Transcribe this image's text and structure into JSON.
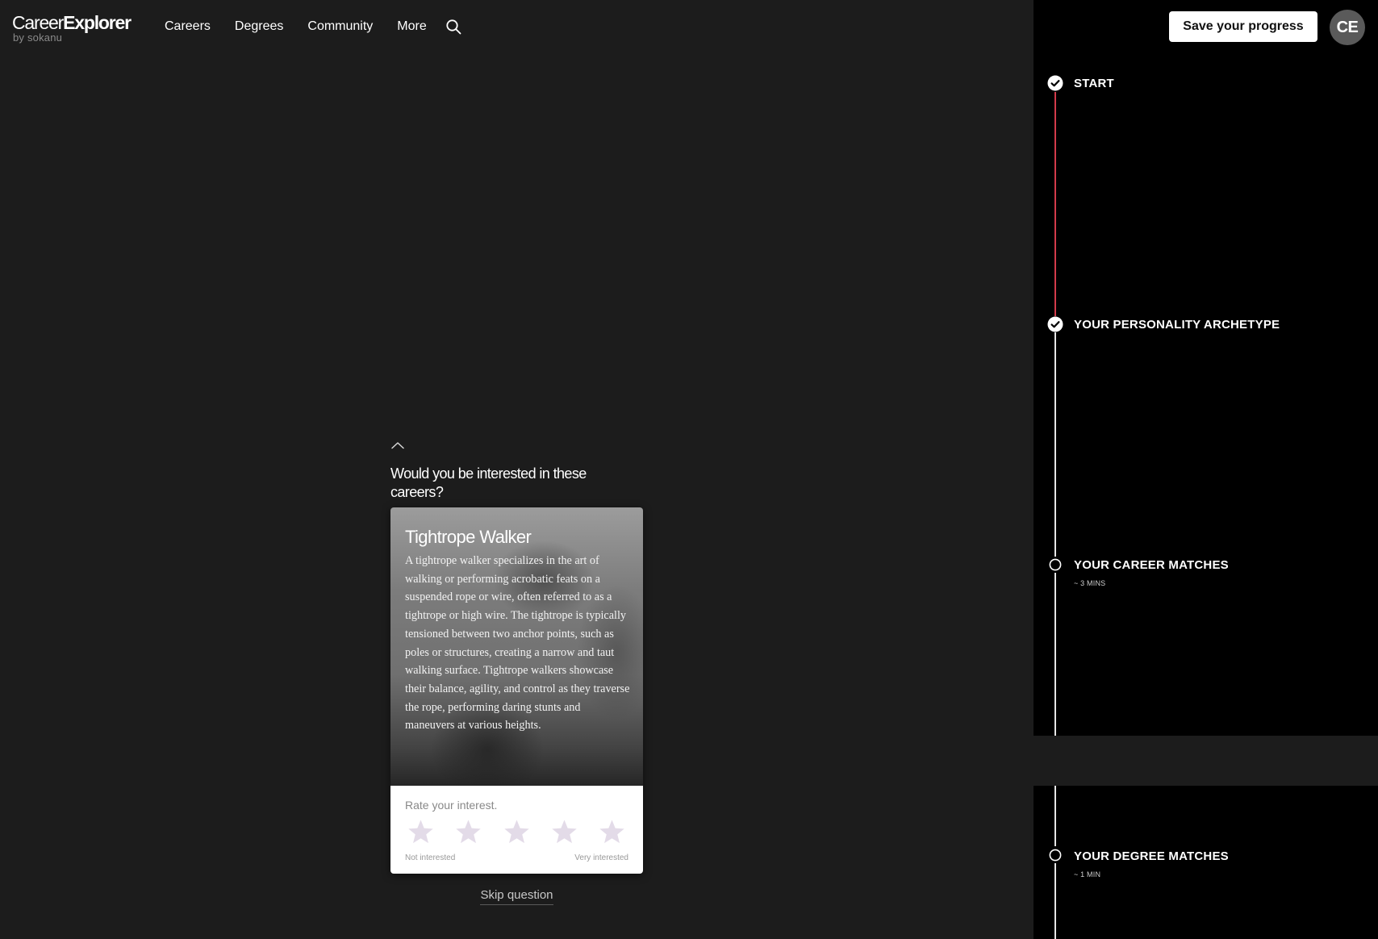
{
  "logo": {
    "brand_light": "Career",
    "brand_bold": "Explorer",
    "sub": "by sokanu"
  },
  "nav": {
    "items": [
      {
        "label": "Careers"
      },
      {
        "label": "Degrees"
      },
      {
        "label": "Community"
      },
      {
        "label": "More"
      }
    ],
    "search_icon": "search-icon"
  },
  "header": {
    "save_label": "Save your progress",
    "avatar_initials": "CE"
  },
  "timeline": {
    "steps": [
      {
        "label": "START",
        "sub": "",
        "status": "complete"
      },
      {
        "label": "YOUR PERSONALITY ARCHETYPE",
        "sub": "",
        "status": "complete"
      },
      {
        "label": "YOUR CAREER MATCHES",
        "sub": "~ 3 MINS",
        "status": "pending"
      },
      {
        "label": "YOUR DEGREE MATCHES",
        "sub": "~ 1 MIN",
        "status": "pending"
      }
    ],
    "active_line_color": "#d23a4a"
  },
  "question": {
    "text": "Would you be interested in these careers?",
    "collapse_icon": "chevron-up-icon"
  },
  "card": {
    "title": "Tightrope Walker",
    "description": "A tightrope walker specializes in the art of walking or performing acrobatic feats on a suspended rope or wire, often referred to as a tightrope or high wire. The tightrope is typically tensioned between two anchor points, such as poles or structures, creating a narrow and taut walking surface. Tightrope walkers showcase their balance, agility, and control as they traverse the rope, performing daring stunts and maneuvers at various heights.",
    "rate_label": "Rate your interest.",
    "rating_max": 5,
    "scale_min_label": "Not interested",
    "scale_max_label": "Very interested",
    "star_color": "#e3dbe8"
  },
  "skip_label": "Skip question"
}
